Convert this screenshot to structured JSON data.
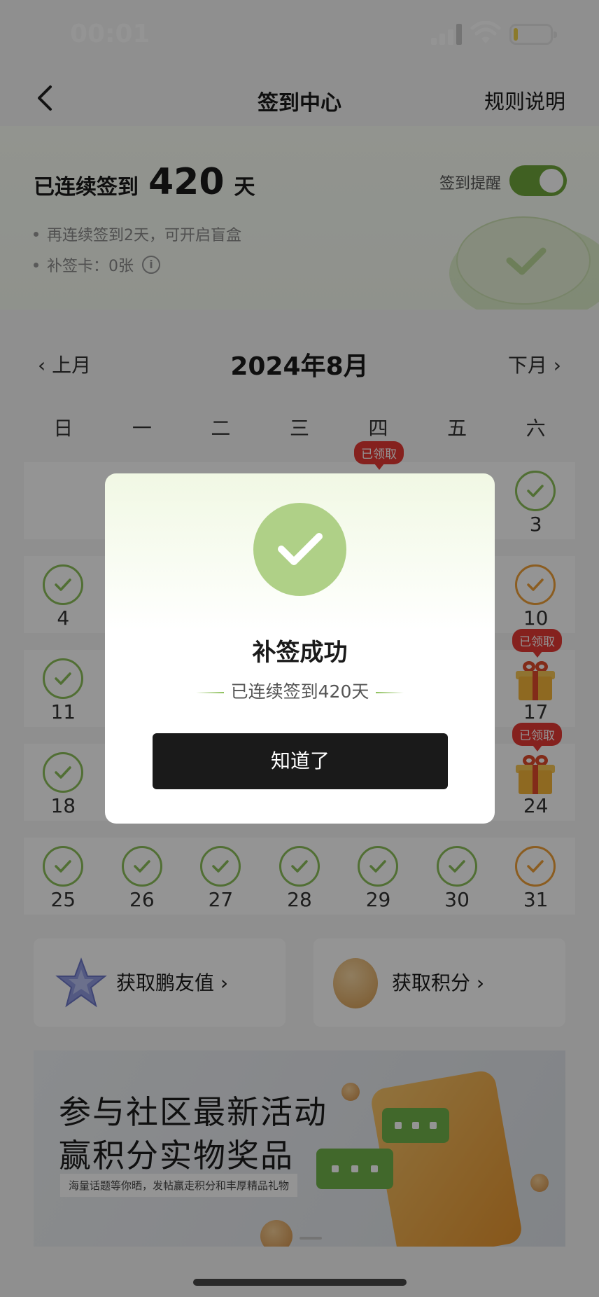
{
  "status_bar": {
    "time": "00:01"
  },
  "header": {
    "title": "签到中心",
    "rules_label": "规则说明"
  },
  "summary": {
    "streak_prefix": "已连续签到",
    "streak_days": "420",
    "streak_suffix": "天",
    "tip_1": "再连续签到2天，可开启盲盒",
    "tip_2": "补签卡：0张",
    "remind_label": "签到提醒",
    "remind_on": true
  },
  "calendar": {
    "prev_label": "上月",
    "next_label": "下月",
    "month_title": "2024年8月",
    "weekdays": [
      "日",
      "一",
      "二",
      "三",
      "四",
      "五",
      "六"
    ],
    "claimed_tag": "已领取",
    "visible_days": {
      "d3": "3",
      "d4": "4",
      "d10": "10",
      "d11": "11",
      "d17": "17",
      "d18": "18",
      "d24": "24",
      "d25": "25",
      "d26": "26",
      "d27": "27",
      "d28": "28",
      "d29": "29",
      "d30": "30",
      "d31": "31"
    }
  },
  "earn": {
    "friend_value": "获取鹏友值",
    "points": "获取积分"
  },
  "banner": {
    "line_1": "参与社区最新活动",
    "line_2": "赢积分实物奖品",
    "subtitle": "海量话题等你晒，发帖赢走积分和丰厚精品礼物"
  },
  "modal": {
    "title": "补签成功",
    "subtitle": "已连续签到420天",
    "button": "知道了"
  },
  "colors": {
    "accent_green": "#8cbf5a",
    "toggle_green": "#6fa63c",
    "claimed_red": "#e53a35",
    "button_dark": "#1a1a1a"
  }
}
